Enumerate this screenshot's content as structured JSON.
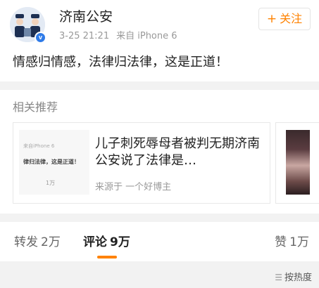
{
  "post": {
    "username": "济南公安",
    "verified_badge": "v",
    "date": "3-25 21:21",
    "source": "来自 iPhone 6",
    "follow_label": "关注",
    "follow_plus": "+",
    "text": "情感归情感，法律归法律，这是正道！"
  },
  "recommend": {
    "section_title": "相关推荐",
    "card": {
      "title": "儿子刺死辱母者被判无期济南公安说了法律是…",
      "source": "来源于 一个好博主",
      "thumb_source": "来自iPhone 6",
      "thumb_text": "律归法律，这是正道！",
      "thumb_count": "1万"
    }
  },
  "tabs": {
    "forward_label": "转发",
    "forward_count": "2万",
    "comment_label": "评论",
    "comment_count": "9万",
    "like_label": "赞",
    "like_count": "1万"
  },
  "sort": {
    "icon": "sort-lines-icon",
    "label": "按热度"
  },
  "colors": {
    "accent": "#ff8200",
    "verified": "#2f7be8",
    "background": "#f2f2f2"
  }
}
